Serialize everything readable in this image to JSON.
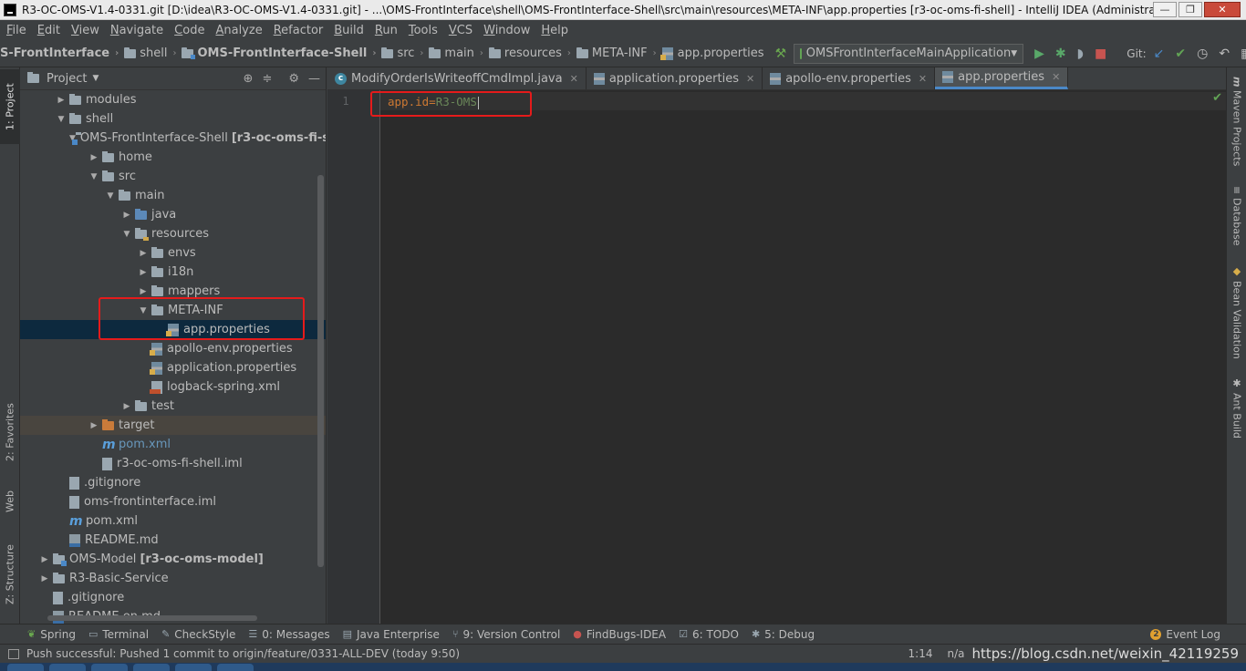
{
  "window": {
    "title": "R3-OC-OMS-V1.4-0331.git [D:\\idea\\R3-OC-OMS-V1.4-0331.git] - ...\\OMS-FrontInterface\\shell\\OMS-FrontInterface-Shell\\src\\main\\resources\\META-INF\\app.properties [r3-oc-oms-fi-shell] - IntelliJ IDEA (Administra...",
    "min": "—",
    "max": "❐",
    "close": "✕"
  },
  "menu": [
    "File",
    "Edit",
    "View",
    "Navigate",
    "Code",
    "Analyze",
    "Refactor",
    "Build",
    "Run",
    "Tools",
    "VCS",
    "Window",
    "Help"
  ],
  "breadcrumb": [
    "S-FrontInterface",
    "shell",
    "OMS-FrontInterface-Shell",
    "src",
    "main",
    "resources",
    "META-INF",
    "app.properties"
  ],
  "run_config": "OMSFrontInterfaceMainApplication",
  "git_label": "Git:",
  "left_stripe": {
    "project": "1: Project",
    "favorites": "2: Favorites",
    "web": "Web",
    "structure": "Z: Structure"
  },
  "right_stripe": {
    "maven": "Maven Projects",
    "database": "Database",
    "bean": "Bean Validation",
    "ant": "Ant Build"
  },
  "project_panel": {
    "title": "Project",
    "tree": [
      {
        "label": "modules",
        "extra": ""
      },
      {
        "label": "shell",
        "extra": ""
      },
      {
        "label": "OMS-FrontInterface-Shell",
        "extra": "[r3-oc-oms-fi-s"
      },
      {
        "label": "home",
        "extra": ""
      },
      {
        "label": "src",
        "extra": ""
      },
      {
        "label": "main",
        "extra": ""
      },
      {
        "label": "java",
        "extra": ""
      },
      {
        "label": "resources",
        "extra": ""
      },
      {
        "label": "envs",
        "extra": ""
      },
      {
        "label": "i18n",
        "extra": ""
      },
      {
        "label": "mappers",
        "extra": ""
      },
      {
        "label": "META-INF",
        "extra": ""
      },
      {
        "label": "app.properties",
        "extra": ""
      },
      {
        "label": "apollo-env.properties",
        "extra": ""
      },
      {
        "label": "application.properties",
        "extra": ""
      },
      {
        "label": "logback-spring.xml",
        "extra": ""
      },
      {
        "label": "test",
        "extra": ""
      },
      {
        "label": "target",
        "extra": ""
      },
      {
        "label": "pom.xml",
        "extra": ""
      },
      {
        "label": "r3-oc-oms-fi-shell.iml",
        "extra": ""
      },
      {
        "label": ".gitignore",
        "extra": ""
      },
      {
        "label": "oms-frontinterface.iml",
        "extra": ""
      },
      {
        "label": "pom.xml",
        "extra": ""
      },
      {
        "label": "README.md",
        "extra": ""
      },
      {
        "label": "OMS-Model",
        "extra": "[r3-oc-oms-model]"
      },
      {
        "label": "R3-Basic-Service",
        "extra": ""
      },
      {
        "label": ".gitignore",
        "extra": ""
      },
      {
        "label": "README.en.md",
        "extra": ""
      }
    ]
  },
  "editor": {
    "tabs": [
      "ModifyOrderIsWriteoffCmdImpl.java",
      "application.properties",
      "apollo-env.properties",
      "app.properties"
    ],
    "active_tab": "app.properties",
    "line_number": "1",
    "code_key": "app.id",
    "code_eq": "=",
    "code_value": "R3-OMS"
  },
  "bottom_tools": [
    "Spring",
    "Terminal",
    "CheckStyle",
    "0: Messages",
    "Java Enterprise",
    "9: Version Control",
    "FindBugs-IDEA",
    "6: TODO",
    "5: Debug"
  ],
  "event_log": "Event Log",
  "event_log_count": "2",
  "status": {
    "message": "Push successful: Pushed 1 commit to origin/feature/0331-ALL-DEV (today 9:50)",
    "position": "1:14",
    "encoding": "n/a",
    "watermark": "https://blog.csdn.net/weixin_42119259"
  },
  "colors": {
    "highlight_box": "#e51b1b",
    "selection": "#0d293e",
    "accent": "#4a88c7"
  }
}
